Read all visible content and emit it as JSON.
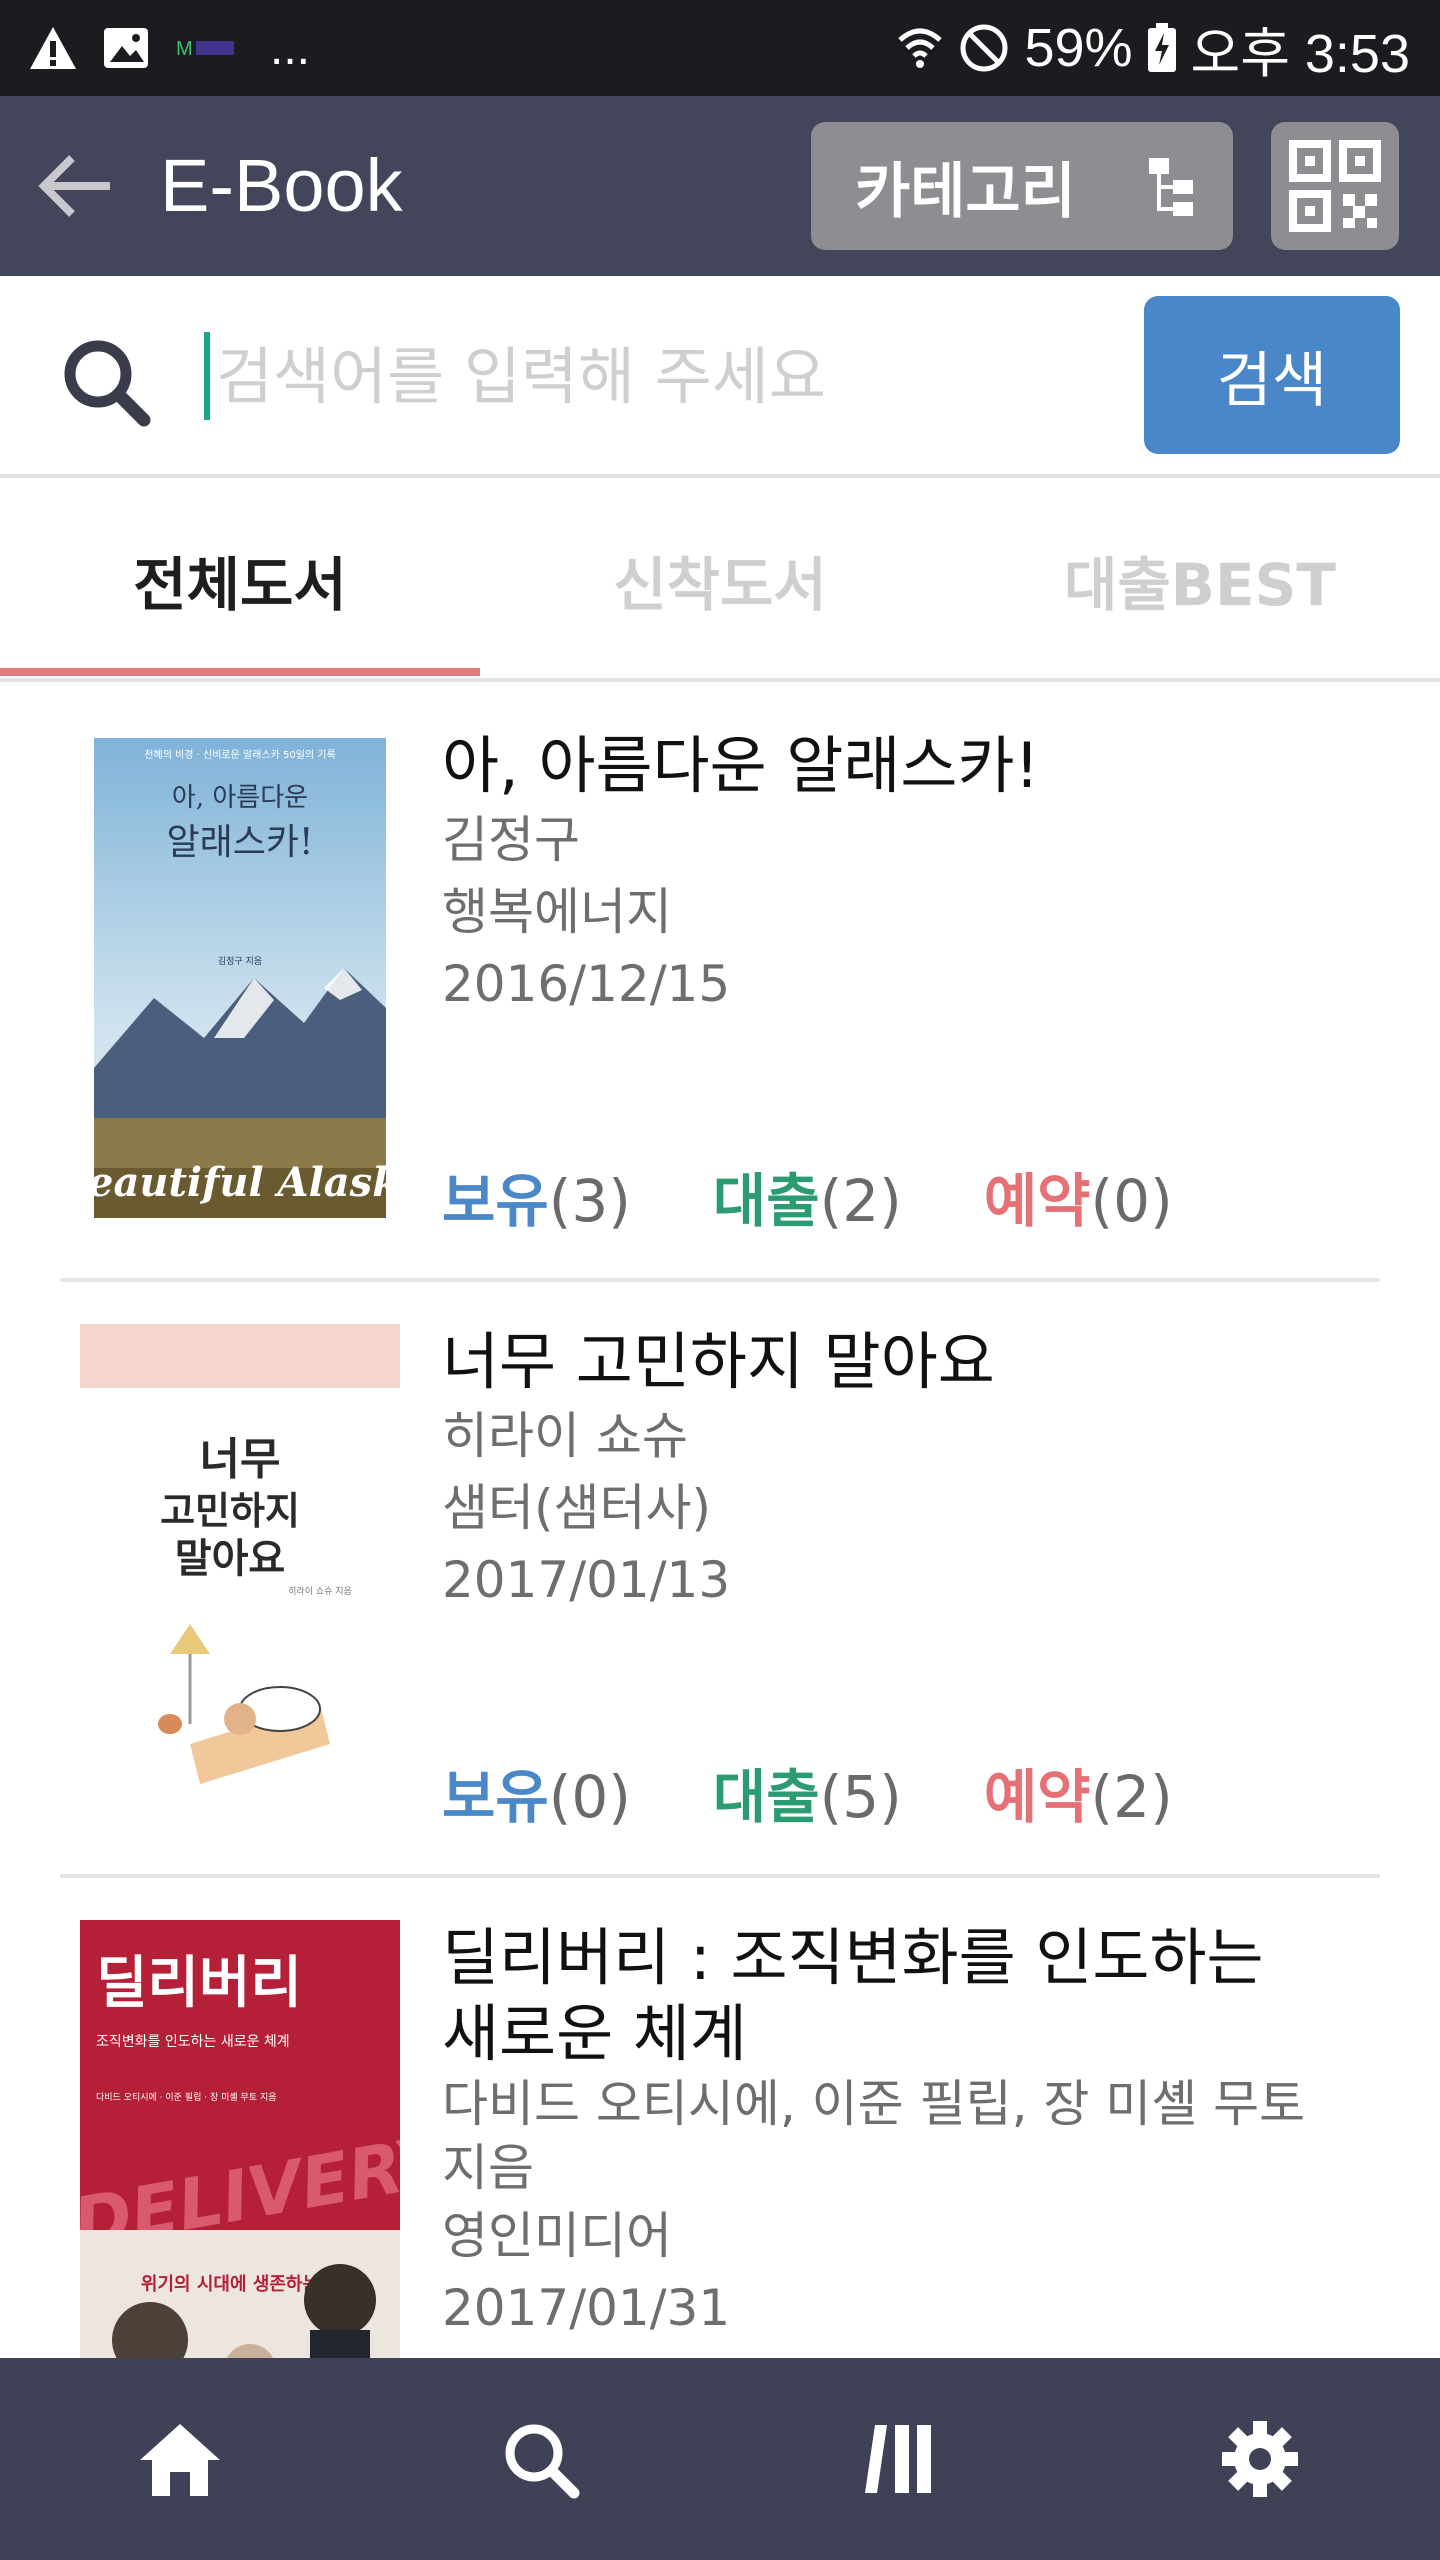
{
  "status_bar": {
    "battery": "59%",
    "time": "오후 3:53",
    "more": "..."
  },
  "app_bar": {
    "title": "E-Book",
    "category_label": "카테고리"
  },
  "search": {
    "placeholder": "검색어를 입력해 주세요",
    "value": "",
    "button_label": "검색"
  },
  "tabs": [
    {
      "label": "전체도서",
      "active": true
    },
    {
      "label": "신착도서",
      "active": false
    },
    {
      "label": "대출BEST",
      "active": false
    }
  ],
  "books": [
    {
      "title": "아, 아름다운 알래스카!",
      "author": "김정구",
      "publisher": "행복에너지",
      "date": "2016/12/15",
      "own_label": "보유",
      "own_count": "(3)",
      "loan_label": "대출",
      "loan_count": "(2)",
      "reserve_label": "예약",
      "reserve_count": "(0)",
      "cover": {
        "top_text": "천혜의 비경 · 신비로운 알래스카 50일의 기록",
        "title_line1": "아, 아름다운",
        "title_line2": "알래스카!",
        "author": "김정구 지음",
        "footer": "Beautiful Alaska"
      }
    },
    {
      "title": "너무 고민하지 말아요",
      "author": "히라이 쇼슈",
      "publisher": "샘터(샘터사)",
      "date": "2017/01/13",
      "own_label": "보유",
      "own_count": "(0)",
      "loan_label": "대출",
      "loan_count": "(5)",
      "reserve_label": "예약",
      "reserve_count": "(2)",
      "cover": {
        "line1": "너무",
        "line2": "고민하지",
        "line3": "말아요",
        "author": "히라이 쇼슈 지음"
      }
    },
    {
      "title_line1": "딜리버리 : 조직변화를 인도하는",
      "title_line2": "새로운 체계",
      "author_line1": "다비드 오티시에, 이준 필립, 장 미셸 무토",
      "author_line2": "지음",
      "publisher": "영인미디어",
      "date": "2017/01/31",
      "cover": {
        "title": "딜리버리",
        "subtitle": "조직변화를 인도하는 새로운 체계",
        "authors": "다비드 오티시에 · 이준 필립 · 장 미셸 무토 지음",
        "big": "DELIVERY",
        "tagline": "위기의 시대에 생존하는"
      }
    }
  ],
  "bottom_nav": [
    "home-icon",
    "search-icon",
    "library-icon",
    "gear-icon"
  ],
  "colors": {
    "app_bar": "#43455a",
    "search_button": "#4a87c8",
    "tab_underline": "#e27c7c",
    "own": "#4a88c9",
    "loan": "#2c9b72",
    "reserve": "#e57176"
  }
}
